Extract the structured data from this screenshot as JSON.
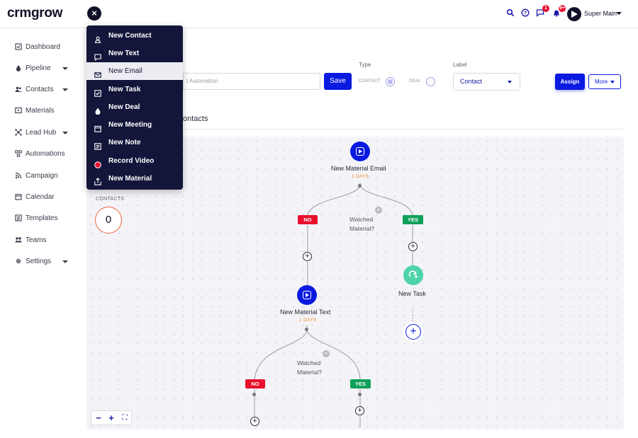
{
  "app": {
    "logo": "crmgrow",
    "close_icon": "×"
  },
  "header": {
    "icons": [
      "search-icon",
      "help-icon",
      "messages-icon",
      "notifications-icon"
    ],
    "messages_badge": "1",
    "notifications_badge": "9+",
    "user_name": "Super Main"
  },
  "sidebar": {
    "items": [
      {
        "label": "Dashboard",
        "icon": "dashboard-icon"
      },
      {
        "label": "Pipeline",
        "icon": "pipeline-icon"
      },
      {
        "label": "Contacts",
        "icon": "contacts-icon"
      },
      {
        "label": "Materials",
        "icon": "materials-icon"
      },
      {
        "label": "Lead Hub",
        "icon": "lead-hub-icon"
      },
      {
        "label": "Automations",
        "icon": "automations-icon"
      },
      {
        "label": "Campaign",
        "icon": "campaign-icon"
      },
      {
        "label": "Calendar",
        "icon": "calendar-icon"
      },
      {
        "label": "Templates",
        "icon": "templates-icon"
      },
      {
        "label": "Teams",
        "icon": "teams-icon"
      },
      {
        "label": "Settings",
        "icon": "settings-icon"
      }
    ]
  },
  "menu": {
    "items": [
      {
        "label": "New Contact",
        "icon": "contact-icon"
      },
      {
        "label": "New Text",
        "icon": "text-icon"
      },
      {
        "label": "New Email",
        "icon": "email-icon"
      },
      {
        "label": "New Task",
        "icon": "task-icon"
      },
      {
        "label": "New Deal",
        "icon": "deal-icon"
      },
      {
        "label": "New Meeting",
        "icon": "meeting-icon"
      },
      {
        "label": "New Note",
        "icon": "note-icon"
      },
      {
        "label": "Record Video",
        "icon": "record-icon"
      },
      {
        "label": "New Material",
        "icon": "upload-icon"
      }
    ],
    "highlighted": "New Email"
  },
  "toolbar": {
    "name_input_value": "t Automation",
    "save_label": "Save",
    "type_label": "Type",
    "type_contact": "CONTACT",
    "type_deal": "DEAL",
    "type_selected": "CONTACT",
    "label_label": "Label",
    "label_value": "Contact",
    "assign_label": "Assign",
    "more_label": "More"
  },
  "tabs": {
    "contacts_tab": "ontacts"
  },
  "canvas": {
    "contacts_label": "CONTACTS",
    "contacts_count": "0",
    "zoom": {
      "minus": "−",
      "plus": "+",
      "fit": "⛶"
    }
  },
  "flow": {
    "node1_title": "New Material Email",
    "node1_delay": "1 DAYS",
    "cond1_text_a": "Watched",
    "cond1_text_b": "Material?",
    "no_label": "NO",
    "yes_label": "YES",
    "node2_title": "New Material Text",
    "node2_delay": "1 DAYS",
    "task_title": "New Task",
    "cond2_text_a": "Watched",
    "cond2_text_b": "Material?",
    "colors": {
      "primary": "#0a1ae0",
      "no": "#e8102d",
      "yes": "#0fa05a",
      "task": "#4dd3a8",
      "delay": "#f08a1a"
    }
  }
}
